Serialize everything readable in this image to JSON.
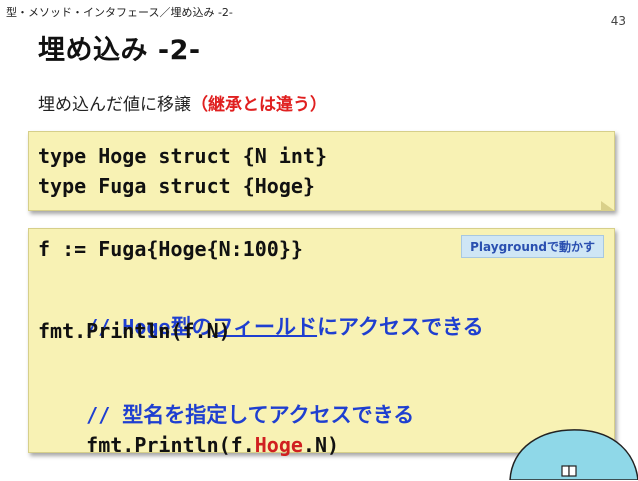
{
  "header": {
    "breadcrumb": "型・メソッド・インタフェース／埋め込み -2-",
    "page_number": "43"
  },
  "slide": {
    "title": "埋め込み -2-",
    "subtitle_main": "埋め込んだ値に移譲",
    "subtitle_note": "（継承とは違う）"
  },
  "code_block_1": {
    "line1": "type Hoge struct {N int}",
    "line2": "type Fuga struct {Hoge}"
  },
  "code_block_2": {
    "line1": "f := Fuga{Hoge{N:100}}",
    "playground_label": "Playgroundで動かす",
    "comment1_prefix": "// ",
    "comment1_code": "Hoge",
    "comment1_text1": "型の",
    "comment1_underlined": "フィールド",
    "comment1_text2": "にアクセスできる",
    "line3": "fmt.Println(f.N)",
    "comment2_prefix": "// ",
    "comment2_text": "型名を指定してアクセスできる",
    "line5_before": "fmt.Println(f.",
    "line5_highlight": "Hoge",
    "line5_after": ".N)"
  },
  "colors": {
    "note_bg": "#f8f2b4",
    "comment_blue": "#1f3fd0",
    "highlight_red": "#d02020",
    "badge_bg": "#cfe6f5"
  }
}
